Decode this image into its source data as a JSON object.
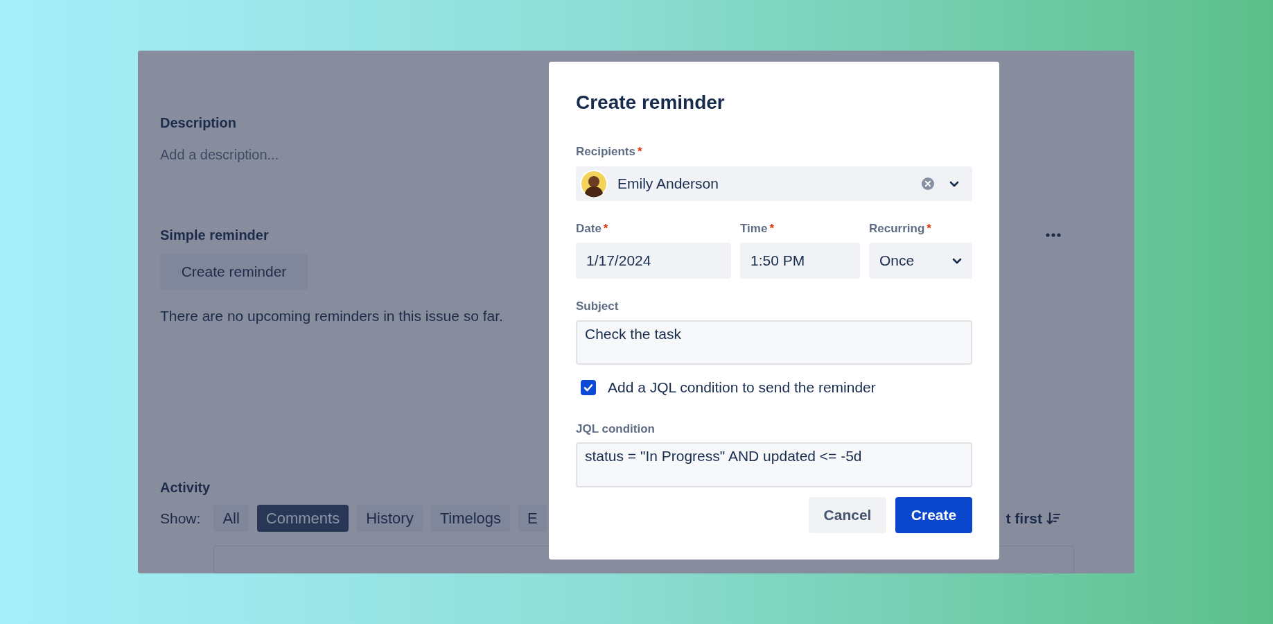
{
  "issue": {
    "description": {
      "heading": "Description",
      "placeholder": "Add a description..."
    },
    "simple_reminder": {
      "heading": "Simple reminder",
      "button": "Create reminder",
      "empty_text": "There are no upcoming reminders in this issue so far."
    },
    "activity": {
      "heading": "Activity",
      "show_label": "Show:",
      "filters": [
        {
          "label": "All",
          "selected": false
        },
        {
          "label": "Comments",
          "selected": true
        },
        {
          "label": "History",
          "selected": false
        },
        {
          "label": "Timelogs",
          "selected": false
        },
        {
          "label": "E",
          "selected": false
        }
      ],
      "sort_label": "t first"
    }
  },
  "dialog": {
    "title": "Create reminder",
    "recipients": {
      "label": "Recipients",
      "required_mark": "*",
      "value": "Emily Anderson"
    },
    "date": {
      "label": "Date",
      "required_mark": "*",
      "value": "1/17/2024"
    },
    "time": {
      "label": "Time",
      "required_mark": "*",
      "value": "1:50 PM"
    },
    "recurring": {
      "label": "Recurring",
      "required_mark": "*",
      "value": "Once"
    },
    "subject": {
      "label": "Subject",
      "value": "Check the task"
    },
    "jql_toggle": {
      "label": "Add a JQL condition to send the reminder",
      "checked": true
    },
    "jql_condition": {
      "label": "JQL condition",
      "value": "status = \"In Progress\" AND updated <= -5d"
    },
    "buttons": [
      {
        "label": "Cancel",
        "kind": "secondary"
      },
      {
        "label": "Create",
        "kind": "primary"
      }
    ]
  }
}
